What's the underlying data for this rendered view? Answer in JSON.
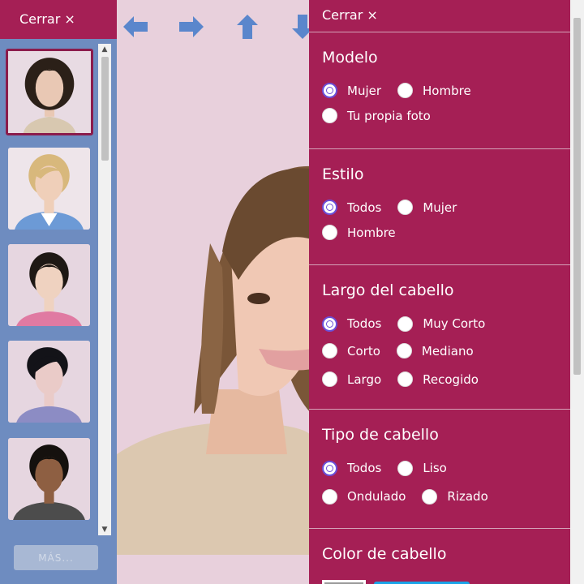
{
  "left_panel": {
    "close_label": "Cerrar ×",
    "more_label": "MÁS..."
  },
  "thumbnails": [
    {
      "name": "model-woman-1",
      "hair": "#2b2018",
      "skin": "#e9c8b4",
      "shirt": "#d8c8b0"
    },
    {
      "name": "model-woman-2",
      "hair": "#d8b87c",
      "skin": "#efcfb9",
      "shirt": "#6c9ad6"
    },
    {
      "name": "model-woman-3",
      "hair": "#1e1814",
      "skin": "#efd2c0",
      "shirt": "#e07aa2"
    },
    {
      "name": "model-woman-4",
      "hair": "#131318",
      "skin": "#eacbc8",
      "shirt": "#8c8cc4"
    },
    {
      "name": "model-woman-5",
      "hair": "#15110e",
      "skin": "#8e5f42",
      "shirt": "#4c4c4c"
    }
  ],
  "nav": {
    "arrow_color": "#5a86cc"
  },
  "filter_panel": {
    "close_label": "Cerrar ×",
    "sections": {
      "modelo": {
        "title": "Modelo",
        "options": [
          "Mujer",
          "Hombre",
          "Tu propia foto"
        ],
        "selected": "Mujer"
      },
      "estilo": {
        "title": "Estilo",
        "options": [
          "Todos",
          "Mujer",
          "Hombre"
        ],
        "selected": "Todos"
      },
      "largo": {
        "title": "Largo del cabello",
        "options": [
          "Todos",
          "Muy Corto",
          "Corto",
          "Mediano",
          "Largo",
          "Recogido"
        ],
        "selected": "Todos"
      },
      "tipo": {
        "title": "Tipo de cabello",
        "options": [
          "Todos",
          "Liso",
          "Ondulado",
          "Rizado"
        ],
        "selected": "Todos"
      },
      "color": {
        "title": "Color de cabello"
      }
    }
  },
  "colors": {
    "accent": "#a51f55",
    "sidebar": "#6e8cc0",
    "radio_selected": "#6a4fd8"
  }
}
